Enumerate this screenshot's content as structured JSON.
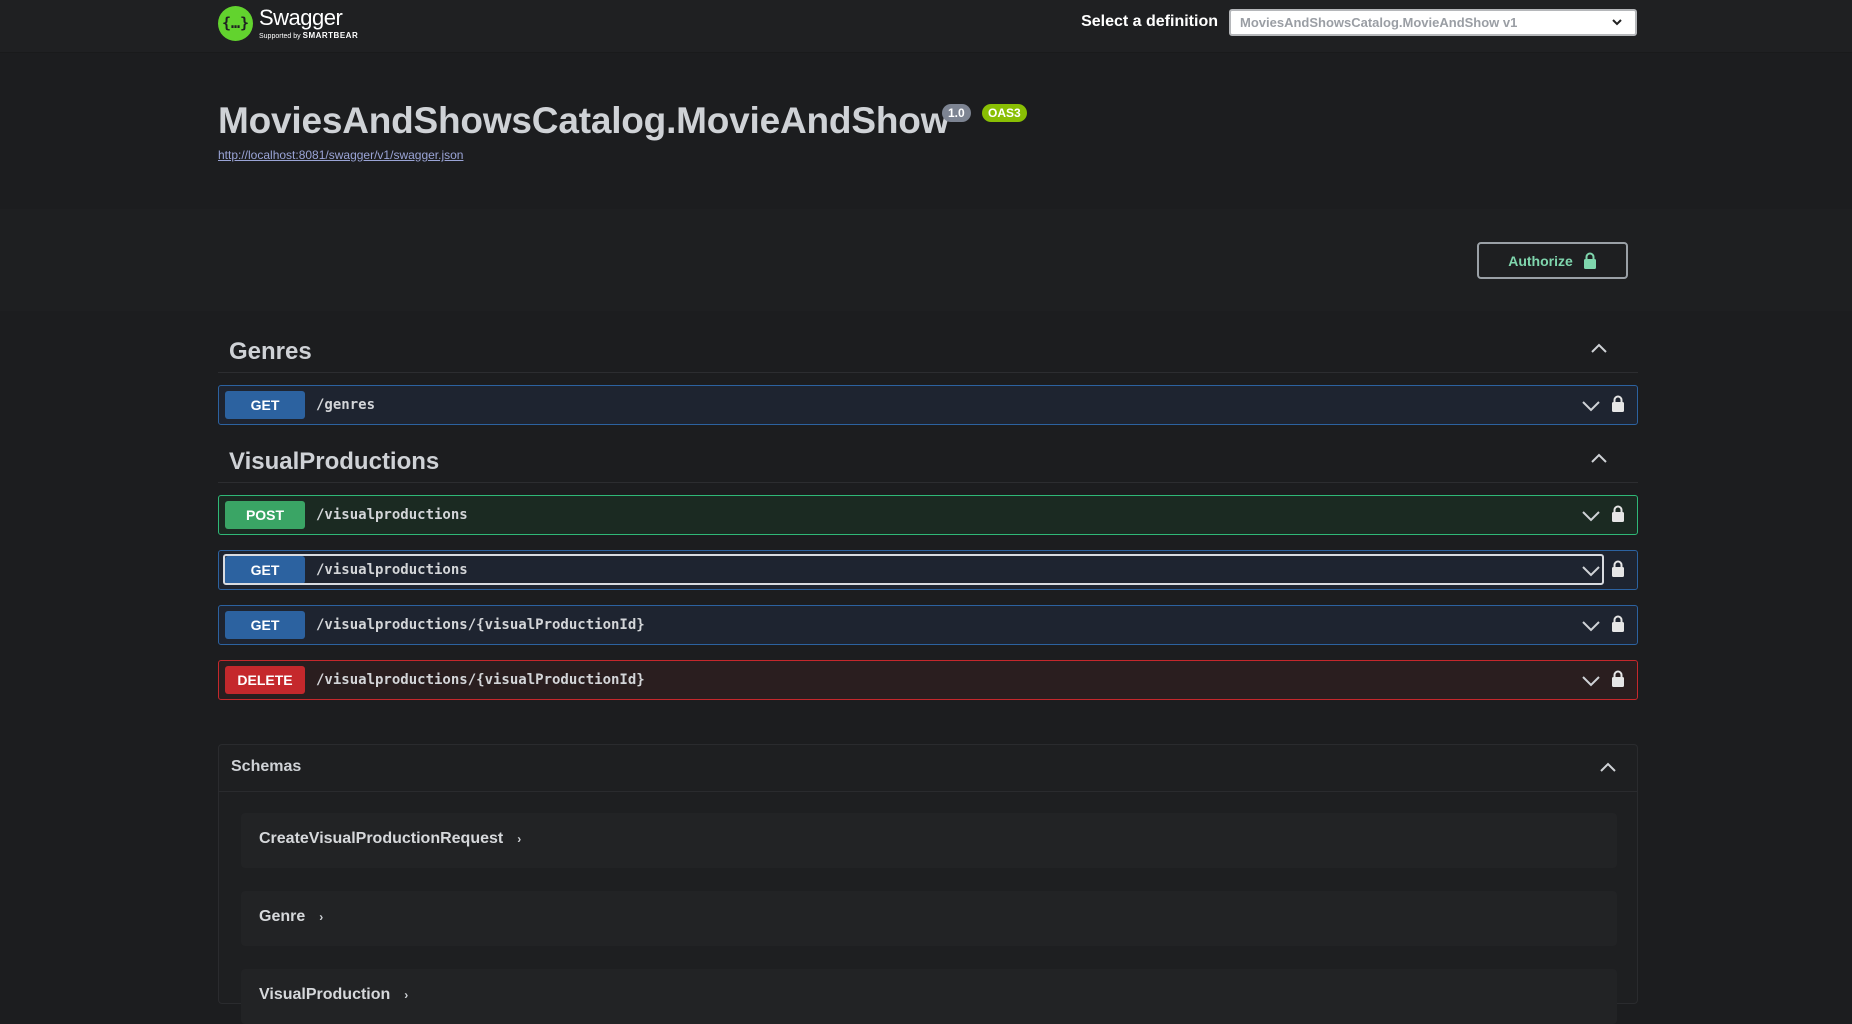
{
  "topbar": {
    "logo_name": "Swagger",
    "logo_sub_prefix": "Supported by",
    "logo_sub_brand": "SMARTBEAR",
    "logo_icon": "{…}",
    "definition_label": "Select a definition",
    "definition_value": "MoviesAndShowsCatalog.MovieAndShow v1"
  },
  "info": {
    "title": "MoviesAndShowsCatalog.MovieAndShow",
    "version": "1.0",
    "oas": "OAS3",
    "url": "http://localhost:8081/swagger/v1/swagger.json"
  },
  "auth": {
    "label": "Authorize",
    "icon": "lock-icon"
  },
  "tags": [
    {
      "name": "Genres",
      "operations": [
        {
          "method": "GET",
          "path": "/genres"
        }
      ]
    },
    {
      "name": "VisualProductions",
      "operations": [
        {
          "method": "POST",
          "path": "/visualproductions"
        },
        {
          "method": "GET",
          "path": "/visualproductions"
        },
        {
          "method": "GET",
          "path": "/visualproductions/{visualProductionId}"
        },
        {
          "method": "DELETE",
          "path": "/visualproductions/{visualProductionId}"
        }
      ]
    }
  ],
  "schemas": {
    "title": "Schemas",
    "models": [
      "CreateVisualProductionRequest",
      "Genre",
      "VisualProduction"
    ]
  },
  "colors": {
    "get": "#2c62a0",
    "post": "#3aa565",
    "delete": "#c5282c",
    "logo": "#62d32e",
    "oas_badge": "#89bf04",
    "version_badge": "#7d8492"
  }
}
